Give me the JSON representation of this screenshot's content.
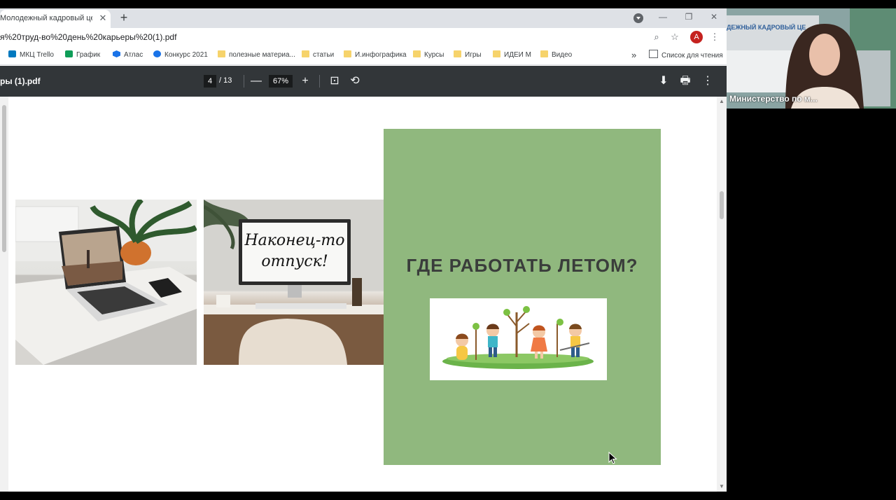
{
  "tab": {
    "title": "Молодежный кадровый центр",
    "close": "✕"
  },
  "new_tab": "+",
  "window_buttons": {
    "minimize": "—",
    "restore": "❐",
    "close": "✕"
  },
  "address_bar": {
    "url": "я%20труд-во%20день%20карьеры%20(1).pdf"
  },
  "toolbar_icons": {
    "zoom": "⌕",
    "star": "☆",
    "menu": "⋮"
  },
  "profile": {
    "initial": "А",
    "color": "#c5221f"
  },
  "bookmarks": {
    "items": [
      {
        "label": "МКЦ Trello",
        "icon": "trello-icon"
      },
      {
        "label": "График",
        "icon": "sheets-icon"
      },
      {
        "label": "Атлас",
        "icon": "atlas-icon"
      },
      {
        "label": "Конкурс 2021",
        "icon": "konkurs-icon"
      },
      {
        "label": "полезные материа...",
        "icon": "folder-icon"
      },
      {
        "label": "статьи",
        "icon": "folder-icon"
      },
      {
        "label": "И.инфографика",
        "icon": "folder-icon"
      },
      {
        "label": "Курсы",
        "icon": "folder-icon"
      },
      {
        "label": "Игры",
        "icon": "folder-icon"
      },
      {
        "label": "ИДЕИ М",
        "icon": "folder-icon"
      },
      {
        "label": "Видео",
        "icon": "folder-icon"
      }
    ],
    "overflow": "»",
    "reading_list": "Список для чтения"
  },
  "pdf_toolbar": {
    "title": "ры (1).pdf",
    "current_page": "4",
    "total_pages": "/ 13",
    "zoom": "67%",
    "zoom_out": "—",
    "zoom_in": "+",
    "fit": "⊡",
    "rotate": "⟲",
    "download": "⬇",
    "print": "🖶",
    "more": "⋮"
  },
  "slide": {
    "title": "ГДЕ РАБОТАТЬ ЛЕТОМ?",
    "photo2_text_line1": "Наконец-то",
    "photo2_text_line2": "отпуск!",
    "green_color": "#90b87e"
  },
  "webcam": {
    "name": "Министерство по м...",
    "background_sign": "ДЕЖНЫЙ КАДРОВЫЙ ЦЕ"
  }
}
